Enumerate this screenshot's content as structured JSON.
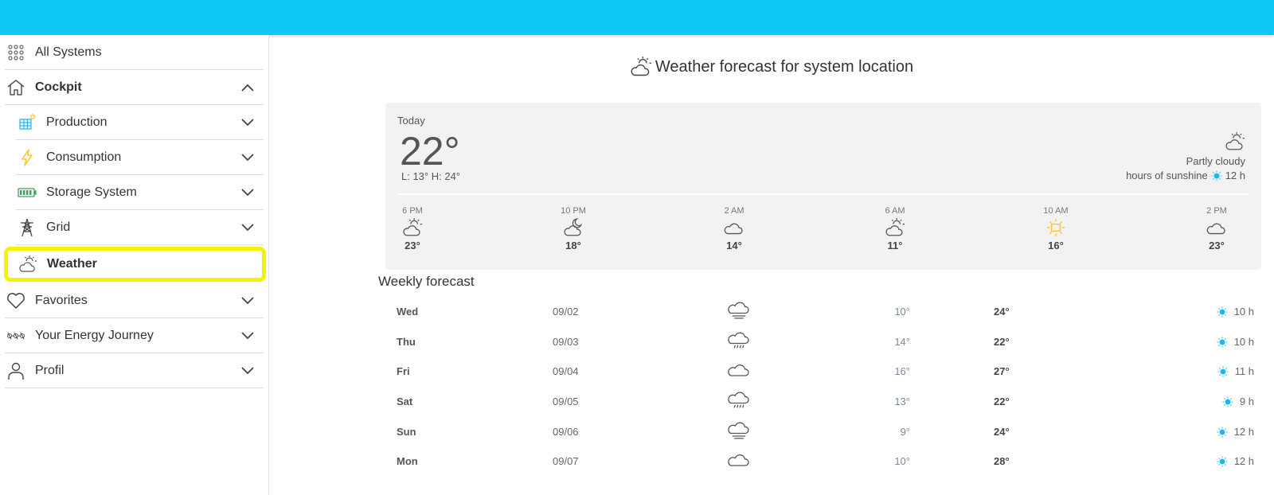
{
  "sidebar": {
    "items": [
      {
        "label": "All Systems",
        "icon": "grid-dots-icon"
      },
      {
        "label": "Cockpit",
        "icon": "home-icon"
      },
      {
        "label": "Production",
        "icon": "solar-panel-icon"
      },
      {
        "label": "Consumption",
        "icon": "lightning-icon"
      },
      {
        "label": "Storage System",
        "icon": "battery-icon"
      },
      {
        "label": "Grid",
        "icon": "power-tower-icon"
      },
      {
        "label": "Weather",
        "icon": "partly-cloudy-icon"
      },
      {
        "label": "Favorites",
        "icon": "heart-icon"
      },
      {
        "label": "Your Energy Journey",
        "icon": "journey-icon"
      },
      {
        "label": "Profil",
        "icon": "user-icon"
      }
    ]
  },
  "main": {
    "title": "Weather forecast for system location",
    "today": {
      "label": "Today",
      "temp": "22°",
      "lowhigh": "L: 13° H: 24°",
      "condition": "Partly cloudy",
      "sunshine_label": "hours of sunshine",
      "sunshine_value": "12 h"
    },
    "hourly": [
      {
        "time": "6 PM",
        "temp": "23°",
        "icon": "partly-cloudy-icon"
      },
      {
        "time": "10 PM",
        "temp": "18°",
        "icon": "moon-cloud-icon"
      },
      {
        "time": "2 AM",
        "temp": "14°",
        "icon": "cloud-icon"
      },
      {
        "time": "6 AM",
        "temp": "11°",
        "icon": "partly-cloudy-icon"
      },
      {
        "time": "10 AM",
        "temp": "16°",
        "icon": "sun-icon"
      },
      {
        "time": "2 PM",
        "temp": "23°",
        "icon": "cloud-icon"
      }
    ],
    "weekly_title": "Weekly forecast",
    "weekly": [
      {
        "day": "Wed",
        "date": "09/02",
        "low": "10°",
        "high": "24°",
        "sun": "10 h",
        "icon": "fog-cloud-icon"
      },
      {
        "day": "Thu",
        "date": "09/03",
        "low": "14°",
        "high": "22°",
        "sun": "10 h",
        "icon": "rain-cloud-icon"
      },
      {
        "day": "Fri",
        "date": "09/04",
        "low": "16°",
        "high": "27°",
        "sun": "11 h",
        "icon": "cloud-icon"
      },
      {
        "day": "Sat",
        "date": "09/05",
        "low": "13°",
        "high": "22°",
        "sun": "9 h",
        "icon": "rain-cloud-icon"
      },
      {
        "day": "Sun",
        "date": "09/06",
        "low": "9°",
        "high": "24°",
        "sun": "12 h",
        "icon": "fog-cloud-icon"
      },
      {
        "day": "Mon",
        "date": "09/07",
        "low": "10°",
        "high": "28°",
        "sun": "12 h",
        "icon": "cloud-icon"
      }
    ]
  },
  "colors": {
    "topbar": "#10c8f5",
    "highlight": "#f4f400",
    "sun": "#1cb8ee",
    "sun_yellow": "#f6c628"
  }
}
